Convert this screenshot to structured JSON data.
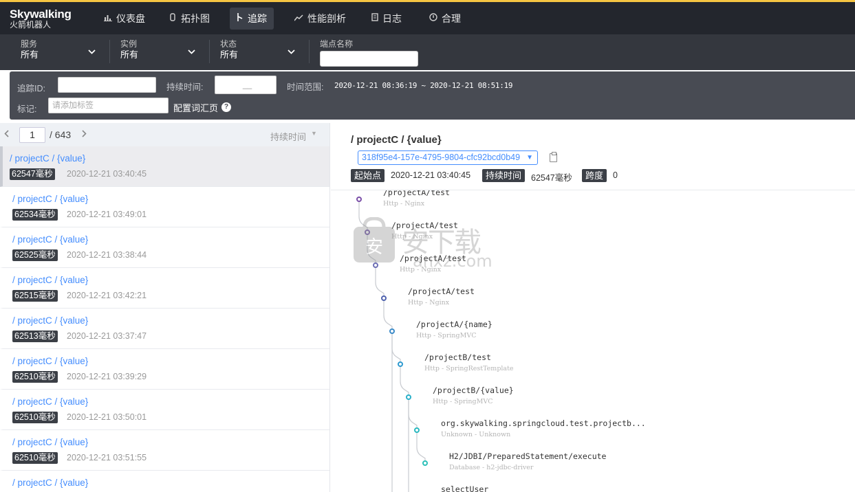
{
  "app": {
    "logo_main": "Skywalking",
    "logo_sub": "火箭机器人"
  },
  "nav": {
    "items": [
      {
        "label": "仪表盘",
        "icon": "dashboard-icon"
      },
      {
        "label": "拓扑图",
        "icon": "topology-icon"
      },
      {
        "label": "追踪",
        "icon": "trace-icon",
        "active": true
      },
      {
        "label": "性能剖析",
        "icon": "profile-icon"
      },
      {
        "label": "日志",
        "icon": "log-icon"
      },
      {
        "label": "合理",
        "icon": "alarm-icon"
      }
    ]
  },
  "filters": {
    "service_label": "服务",
    "service_value": "所有",
    "instance_label": "实例",
    "instance_value": "所有",
    "status_label": "状态",
    "status_value": "所有",
    "endpoint_label": "端点名称",
    "endpoint_value": ""
  },
  "search": {
    "trace_id_label": "追踪ID:",
    "trace_id_value": "",
    "duration_label": "持续时间:",
    "duration_value": "__",
    "time_range_label": "时间范围:",
    "time_range_value": "2020-12-21 08:36:19 ~ 2020-12-21 08:51:19",
    "tags_label": "标记:",
    "tags_placeholder": "请添加标签",
    "config_link": "配置词汇页"
  },
  "pager": {
    "current": "1",
    "total": "/ 643",
    "sort_label": "持续时间"
  },
  "traces": [
    {
      "name": "/ projectC / {value}",
      "duration": "62547毫秒",
      "date": "2020-12-21 03:40:45",
      "selected": true
    },
    {
      "name": "/ projectC / {value}",
      "duration": "62534毫秒",
      "date": "2020-12-21 03:49:01"
    },
    {
      "name": "/ projectC / {value}",
      "duration": "62525毫秒",
      "date": "2020-12-21 03:38:44"
    },
    {
      "name": "/ projectC / {value}",
      "duration": "62515毫秒",
      "date": "2020-12-21 03:42:21"
    },
    {
      "name": "/ projectC / {value}",
      "duration": "62513毫秒",
      "date": "2020-12-21 03:37:47"
    },
    {
      "name": "/ projectC / {value}",
      "duration": "62510毫秒",
      "date": "2020-12-21 03:39:29"
    },
    {
      "name": "/ projectC / {value}",
      "duration": "62510毫秒",
      "date": "2020-12-21 03:50:01"
    },
    {
      "name": "/ projectC / {value}",
      "duration": "62510毫秒",
      "date": "2020-12-21 03:51:55"
    },
    {
      "name": "/ projectC / {value}",
      "duration": "",
      "date": ""
    }
  ],
  "detail": {
    "title": "/ projectC / {value}",
    "trace_id": "318f95e4-157e-4795-9804-cfc92bcd0b49",
    "start_label": "起始点",
    "start_value": "2020-12-21 03:40:45",
    "duration_label": "持续时间",
    "duration_value": "62547毫秒",
    "span_label": "跨度",
    "span_value": "0"
  },
  "spans": [
    {
      "name": "/projectA/test",
      "sub": "Http - Nginx",
      "color": "#7b4fa8"
    },
    {
      "name": "/projectA/test",
      "sub": "Http - Nginx",
      "color": "#7d65b0"
    },
    {
      "name": "/projectA/test",
      "sub": "Http - Nginx",
      "color": "#6e6fb5"
    },
    {
      "name": "/projectA/test",
      "sub": "Http - Nginx",
      "color": "#4f62ae"
    },
    {
      "name": "/projectA/{name}",
      "sub": "Http - SpringMVC",
      "color": "#3a8ac8"
    },
    {
      "name": "/projectB/test",
      "sub": "Http - SpringRestTemplate",
      "color": "#2e9ad0"
    },
    {
      "name": "/projectB/{value}",
      "sub": "Http - SpringMVC",
      "color": "#2ab0c9"
    },
    {
      "name": "org.skywalking.springcloud.test.projectb...",
      "sub": "Unknown - Unknown",
      "color": "#28b8bf"
    },
    {
      "name": "H2/JDBI/PreparedStatement/execute",
      "sub": "Database - h2-jdbc-driver",
      "color": "#2cc0b8"
    },
    {
      "name": "selectUser",
      "sub": "",
      "color": "#2cc0b8"
    }
  ],
  "watermark": {
    "text": "安下载",
    "sub": "anxz.com"
  }
}
